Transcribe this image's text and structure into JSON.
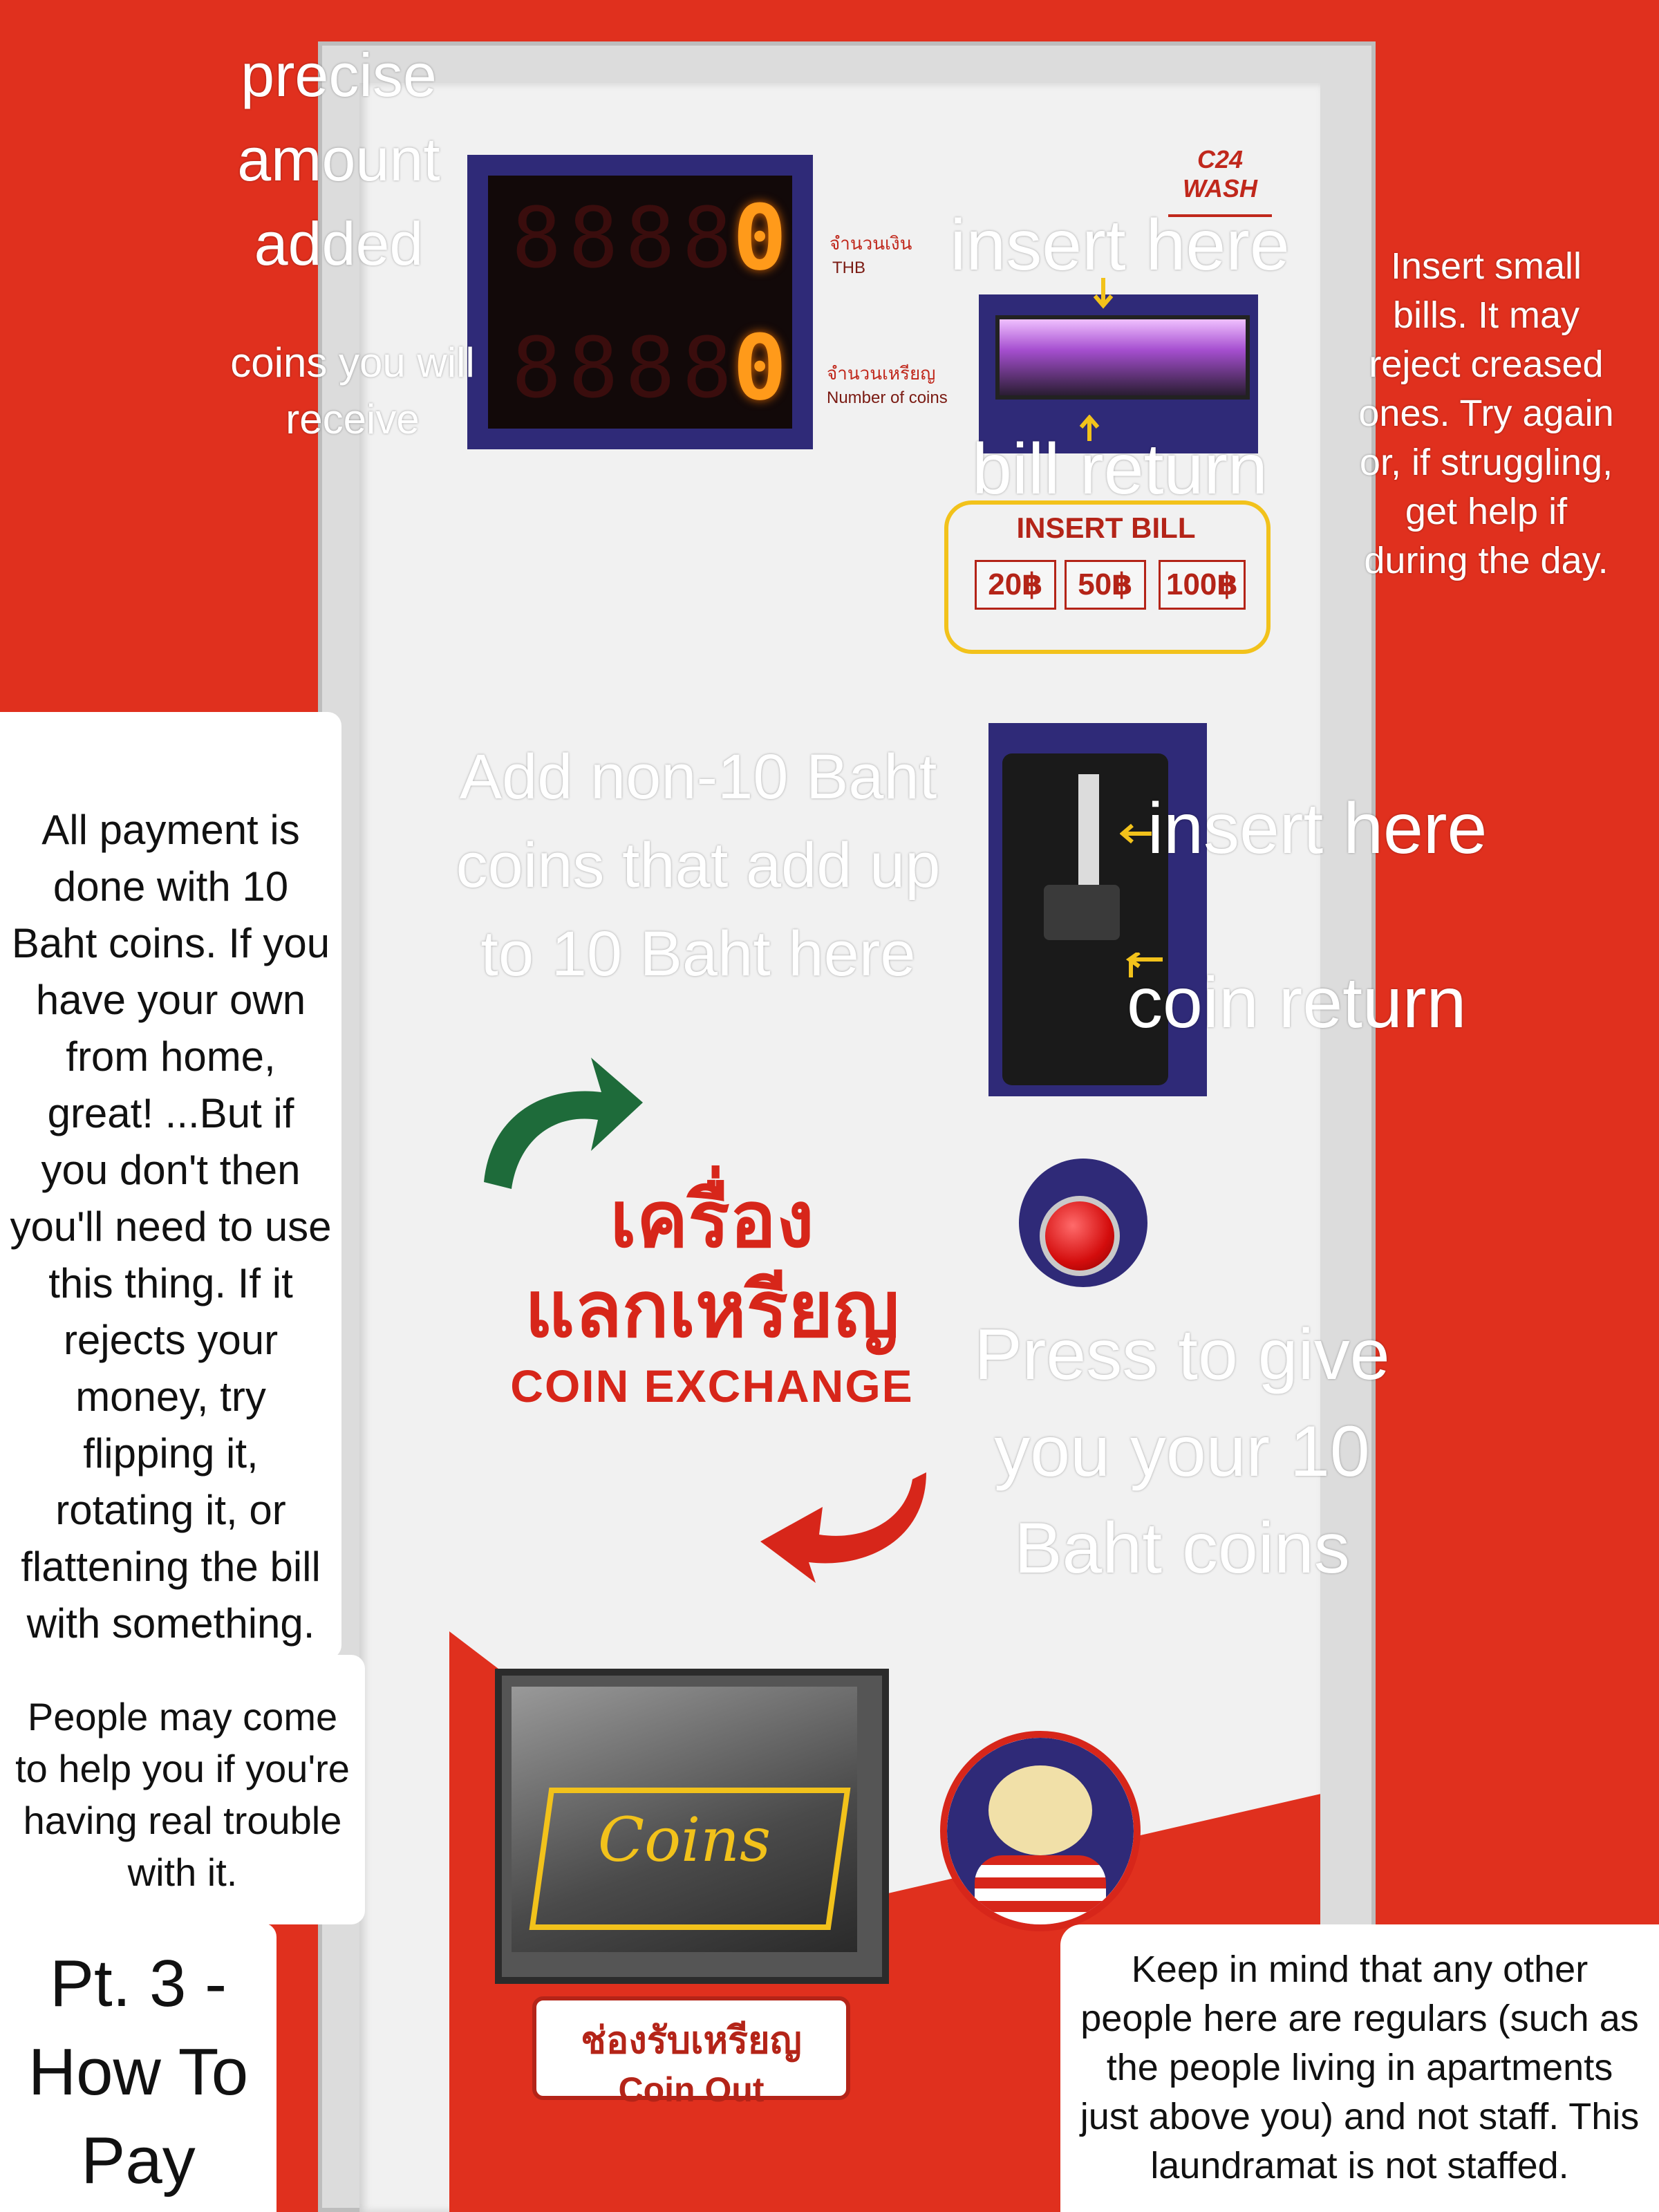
{
  "machine": {
    "display": {
      "amount_value": "0",
      "coins_value": "0",
      "amount_label_th": "จำนวนเงิน",
      "amount_label_en": "THB",
      "coins_label_th": "จำนวนเหรียญ",
      "coins_label_en": "Number of coins"
    },
    "logo_text": "C24 WASH",
    "bill_acceptor": {
      "insert_bill_label": "INSERT BILL",
      "denominations": [
        "20฿",
        "50฿",
        "100฿"
      ]
    },
    "title_th_line1": "เครื่อง",
    "title_th_line2": "แลกเหรียญ",
    "title_en": "COIN EXCHANGE",
    "coin_out_label_th": "ช่องรับเหรียญ",
    "coin_out_label_en": "Coin Out",
    "coins_handwritten": "Coins"
  },
  "annotations": {
    "precise_amount": "precise amount added",
    "coins_receive": "coins you will receive",
    "insert_here_bill": "insert here",
    "bill_return": "bill return",
    "bill_note": "Insert small bills.  It may reject creased ones.  Try again or, if struggling, get help if during the day.",
    "coin_note": "Add non-10 Baht coins that add up to 10 Baht here",
    "insert_here_coin": "insert here",
    "coin_return": "coin return",
    "press_note": "Press to give you your 10 Baht coins",
    "payment_note": "All payment is done with 10 Baht coins.  If you have your own from home, great!  ...But if you don't then you'll need to use this thing.  If it rejects your money, try flipping it, rotating it, or flattening the bill with something.",
    "help_note": "People may come to help you if you're having real trouble with it.",
    "part_title": "Pt. 3 - How To Pay",
    "regulars_note": "Keep in mind that any other people here are regulars (such as the people living in apartments just above you) and not staff.  This laundramat is not staffed."
  },
  "colors": {
    "wall_red": "#e0301e",
    "panel_white": "#f1f1f1",
    "accent_navy": "#2f2a78",
    "highlight_yellow": "#f2c21b",
    "led_orange": "#ff9a1a",
    "arrow_green": "#1e6b3a"
  }
}
